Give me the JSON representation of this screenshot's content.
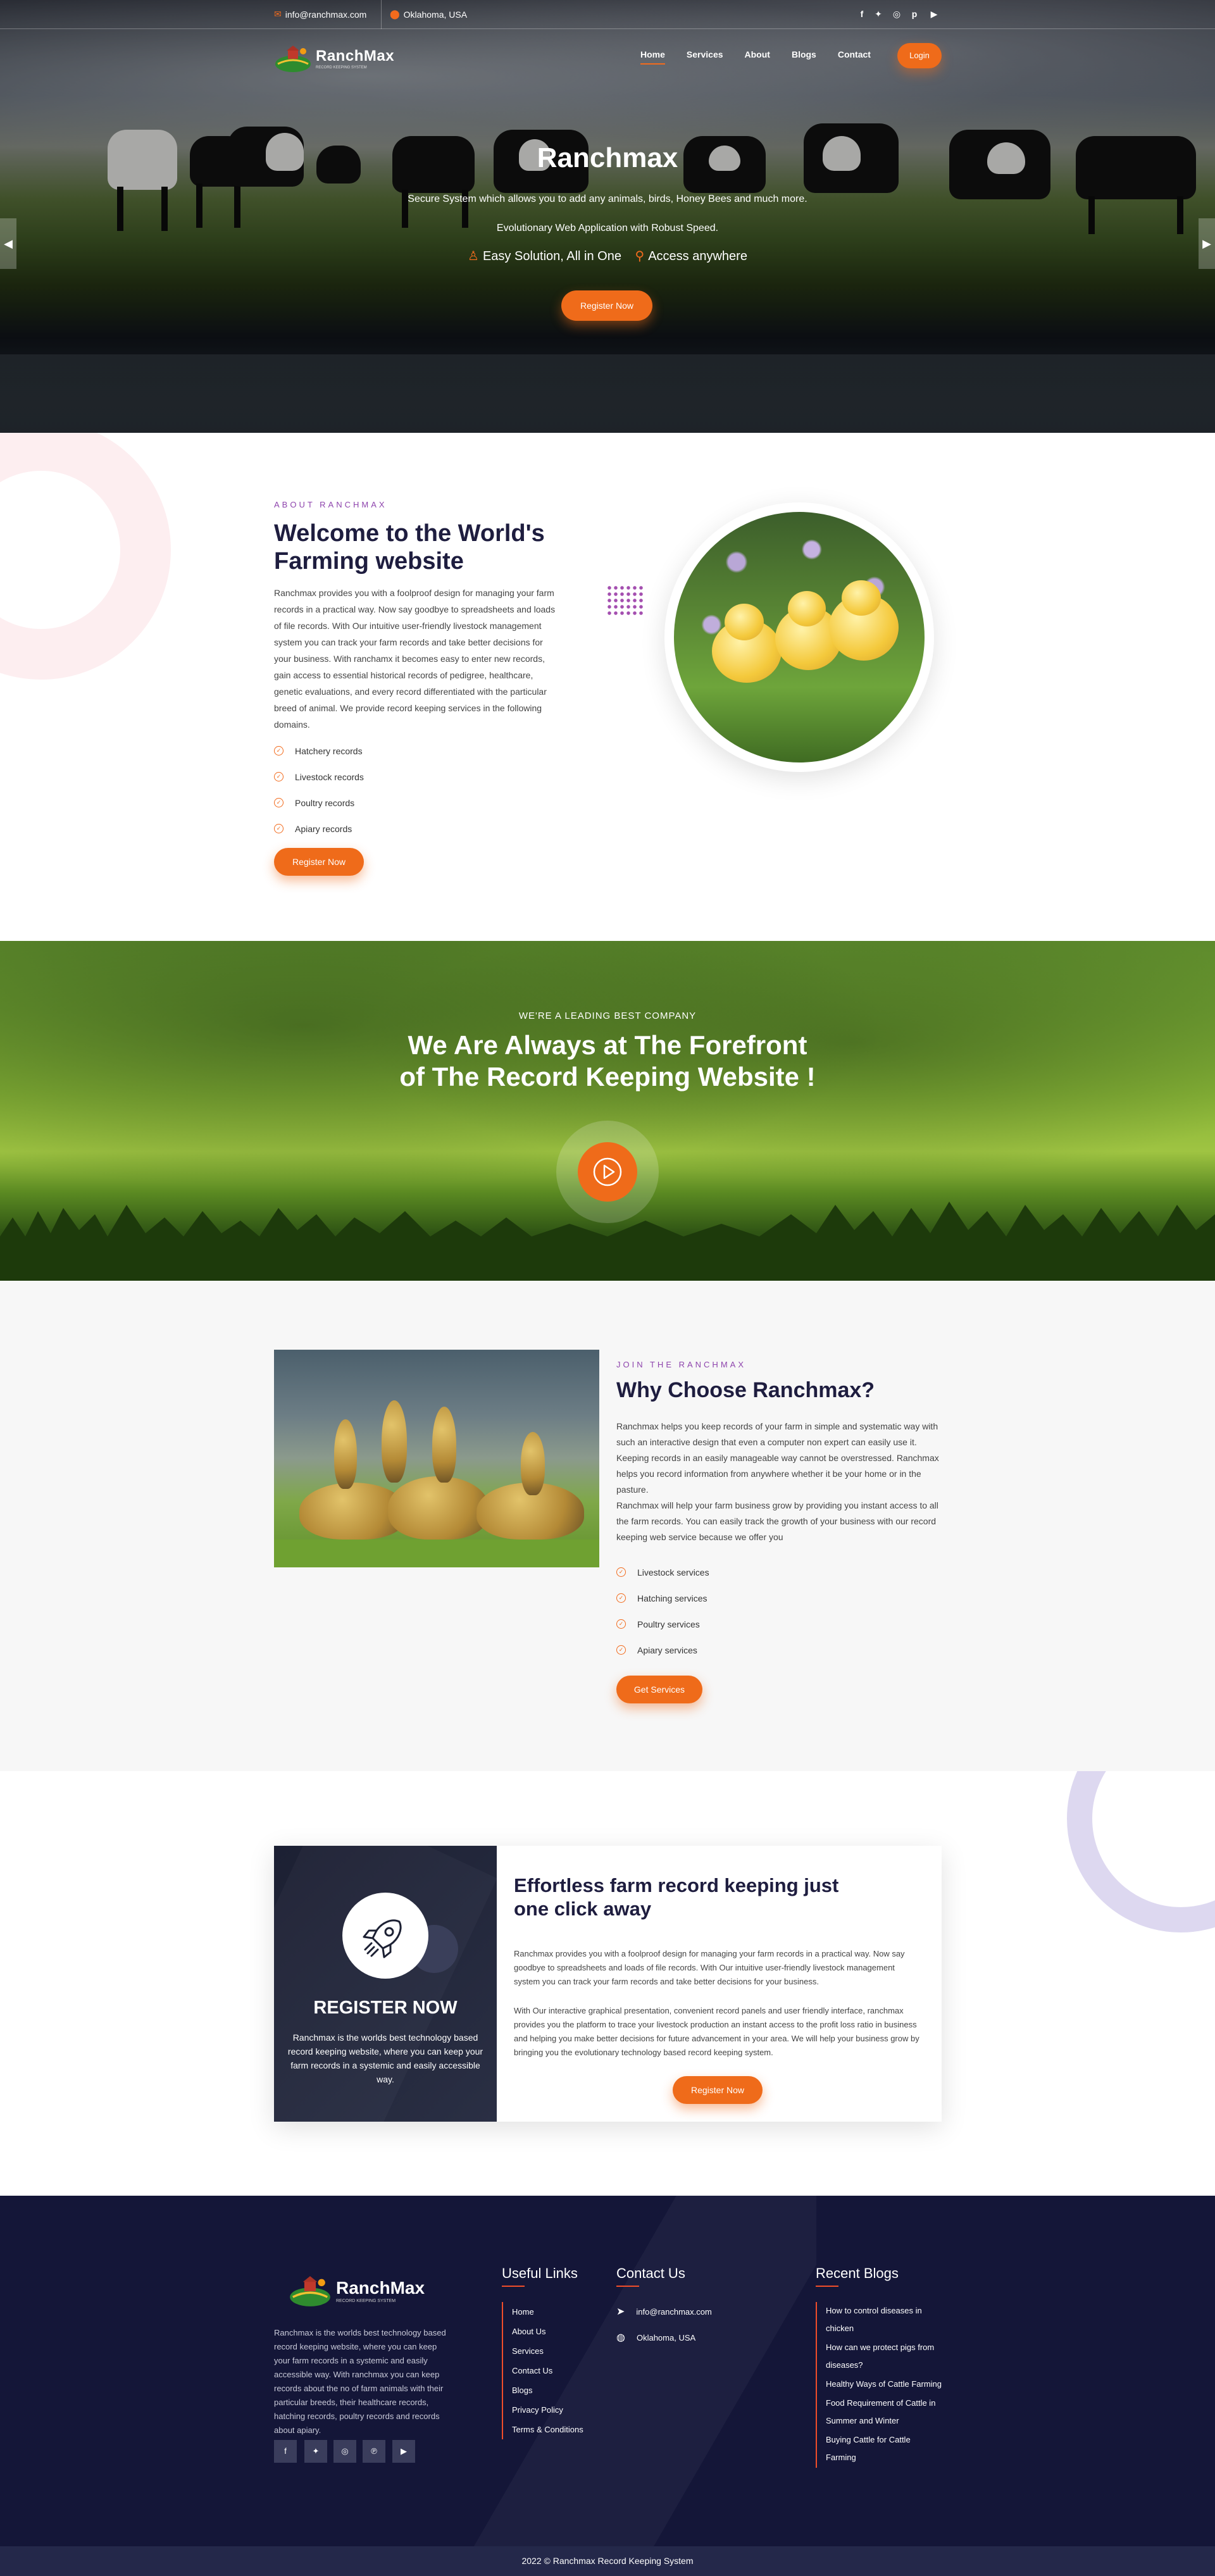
{
  "topbar": {
    "email": "info@ranchmax.com",
    "location": "Oklahoma, USA",
    "social_icons": [
      "facebook-icon",
      "twitter-icon",
      "instagram-icon",
      "pinterest-icon",
      "youtube-icon"
    ]
  },
  "brand": {
    "name": "RanchMax",
    "tagline": "RECORD KEEPING SYSTEM"
  },
  "nav": {
    "items": [
      "Home",
      "Services",
      "About",
      "Blogs",
      "Contact"
    ],
    "active": "Home",
    "login_label": "Login"
  },
  "hero": {
    "title": "Ranchmax",
    "line1": "Secure System which allows you to add any animals, birds, Honey Bees and much more.",
    "line2": "Evolutionary Web Application with Robust Speed.",
    "feature1": "Easy Solution, All in One",
    "feature2": "Access anywhere",
    "cta_label": "Register Now"
  },
  "about": {
    "kicker": "ABOUT RANCHMAX",
    "title_line1": "Welcome to the World's",
    "title_line2": "Farming website",
    "body": "Ranchmax provides you with a foolproof design for managing your farm records in a practical way. Now say goodbye to spreadsheets and loads of file records. With Our intuitive user-friendly livestock management system you can track your farm records and take better decisions for your business. With ranchamx it becomes easy to enter new records, gain access to essential historical records of pedigree, healthcare, genetic evaluations, and every record differentiated with the particular breed of animal. We provide record keeping services in the following domains.",
    "list": [
      "Hatchery records",
      "Livestock records",
      "Poultry records",
      "Apiary records"
    ],
    "cta_label": "Register Now"
  },
  "banner": {
    "kicker": "WE'RE A LEADING BEST COMPANY",
    "title_line1": "We Are Always at The Forefront",
    "title_line2": "of The Record Keeping Website !"
  },
  "why": {
    "kicker": "JOIN THE RANCHMAX",
    "title": "Why Choose Ranchmax?",
    "body1": "Ranchmax helps you keep records of your farm in simple and systematic way with such an interactive design that even a computer non expert can easily use it. Keeping records in an easily manageable way cannot be overstressed. Ranchmax helps you record information from anywhere whether it be your home or in the pasture.",
    "body2": "Ranchmax will help your farm business grow by providing you instant access to all the farm records. You can easily track the growth of your business with our record keeping web service because we offer you",
    "list": [
      "Livestock services",
      "Hatching services",
      "Poultry services",
      "Apiary services"
    ],
    "cta_label": "Get Services"
  },
  "cta": {
    "left_title": "REGISTER NOW",
    "left_text": "Ranchmax is the worlds best technology based record keeping website, where you can keep your farm records in a systemic and easily accessible way.",
    "title_line1": "Effortless farm record keeping just",
    "title_line2": "one click away",
    "para1": "Ranchmax provides you with a foolproof design for managing your farm records in a practical way. Now say goodbye to spreadsheets and loads of file records. With Our intuitive user-friendly livestock management system you can track your farm records and take better decisions for your business.",
    "para2": "With Our interactive graphical presentation, convenient record panels and user friendly interface, ranchmax provides you the platform to trace your livestock production an instant access to the profit loss ratio in business and helping you make better decisions for future advancement in your area. We will help your business grow by bringing you the evolutionary technology based record keeping system.",
    "cta_label": "Register Now"
  },
  "footer": {
    "about_text": "Ranchmax is the worlds best technology based record keeping website, where you can keep your farm records in a systemic and easily accessible way. With ranchmax you can keep records about the no of farm animals with their particular breeds, their healthcare records, hatching records, poultry records and records about apiary.",
    "useful_links_title": "Useful Links",
    "useful_links": [
      "Home",
      "About Us",
      "Services",
      "Contact Us",
      "Blogs",
      "Privacy Policy",
      "Terms & Conditions"
    ],
    "contact_title": "Contact Us",
    "contact_email": "info@ranchmax.com",
    "contact_location": "Oklahoma, USA",
    "blogs_title": "Recent Blogs",
    "blogs": [
      "How to control diseases in chicken",
      "How can we protect pigs from diseases?",
      "Healthy Ways of Cattle Farming",
      "Food Requirement of Cattle in Summer and Winter",
      "Buying Cattle for Cattle Farming"
    ],
    "social_icons": [
      "facebook-icon",
      "twitter-icon",
      "instagram-icon",
      "pinterest-icon",
      "youtube-icon"
    ],
    "copyright": "2022 © Ranchmax Record Keeping System"
  },
  "colors": {
    "accent": "#ef6b1a",
    "navy": "#141638",
    "purple": "#8e44ad",
    "heading": "#1e1d3f"
  }
}
